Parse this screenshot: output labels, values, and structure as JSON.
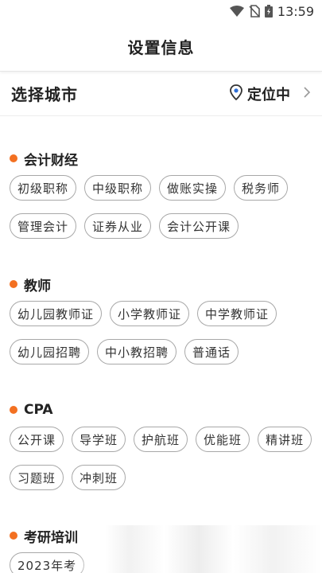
{
  "status_bar": {
    "time": "13:59",
    "icons": [
      "wifi-icon",
      "no-sim-icon",
      "battery-charging-icon"
    ]
  },
  "header": {
    "title": "设置信息"
  },
  "city": {
    "label": "选择城市",
    "locate_label": "定位中",
    "locate_icon": "location-pin-icon",
    "chevron_icon": "chevron-right-icon"
  },
  "colors": {
    "accent_dot": "#f37021",
    "pin_blue": "#2f6fd6"
  },
  "sections": [
    {
      "title": "会计财经",
      "tags": [
        "初级职称",
        "中级职称",
        "做账实操",
        "税务师",
        "管理会计",
        "证券从业",
        "会计公开课"
      ]
    },
    {
      "title": "教师",
      "tags": [
        "幼儿园教师证",
        "小学教师证",
        "中学教师证",
        "幼儿园招聘",
        "中小教招聘",
        "普通话"
      ]
    },
    {
      "title": "CPA",
      "tags": [
        "公开课",
        "导学班",
        "护航班",
        "优能班",
        "精讲班",
        "习题班",
        "冲刺班"
      ]
    },
    {
      "title": "考研培训",
      "tags": [
        "2023年考"
      ]
    }
  ]
}
